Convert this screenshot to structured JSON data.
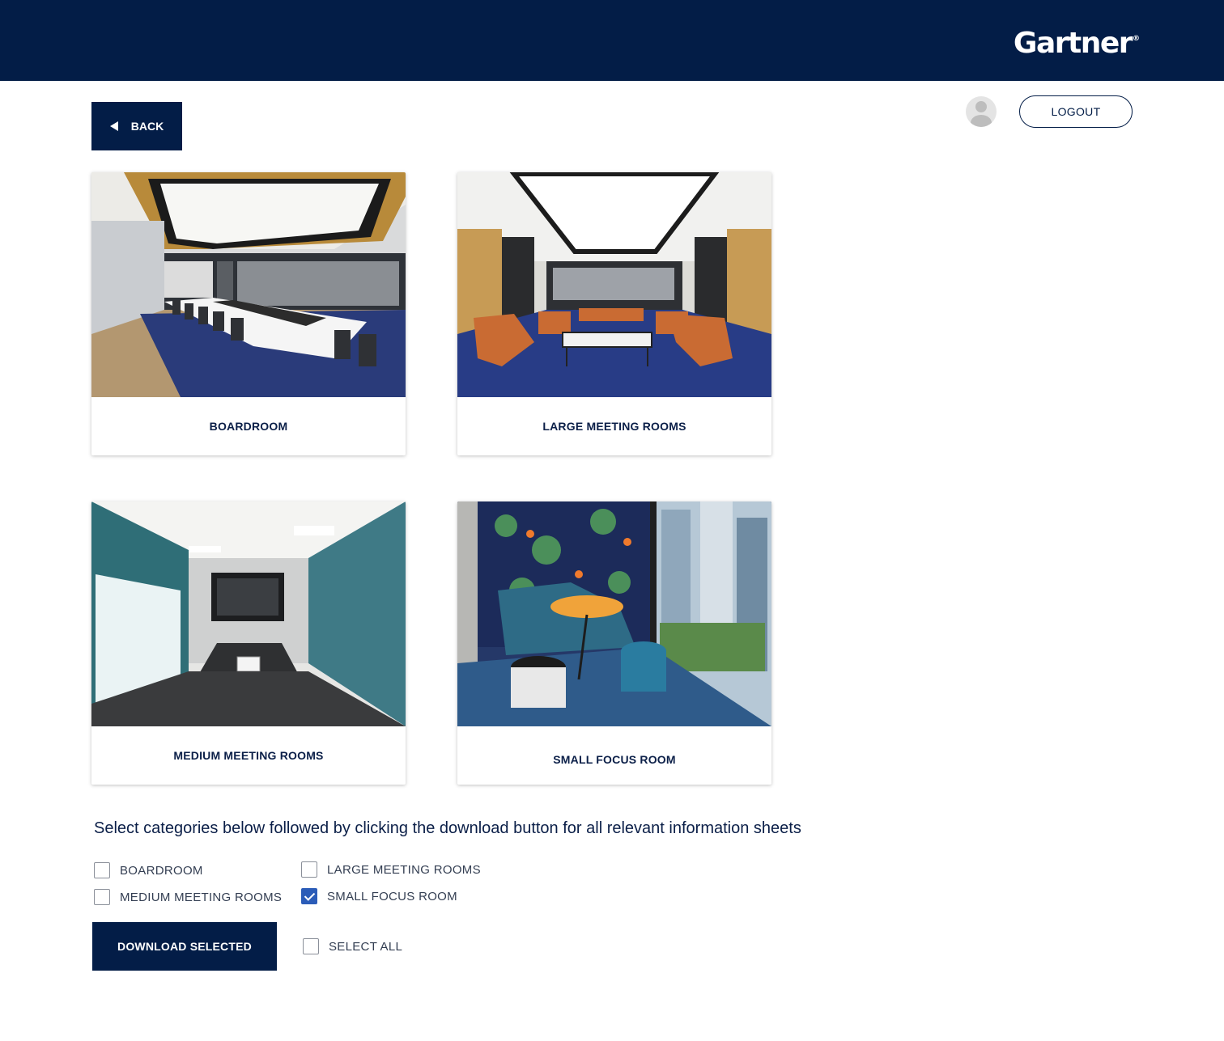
{
  "header": {
    "logo_text": "Gartner",
    "logo_mark": "®"
  },
  "nav": {
    "back_label": "BACK",
    "logout_label": "LOGOUT"
  },
  "cards": [
    {
      "label": "BOARDROOM"
    },
    {
      "label": "LARGE MEETING ROOMS"
    },
    {
      "label": "MEDIUM MEETING ROOMS"
    },
    {
      "label": "SMALL FOCUS ROOM"
    }
  ],
  "selection": {
    "instructions": "Select categories below followed by clicking the download button for all relevant information sheets",
    "options": [
      {
        "label": "BOARDROOM",
        "checked": false
      },
      {
        "label": "LARGE MEETING ROOMS",
        "checked": false
      },
      {
        "label": "MEDIUM MEETING ROOMS",
        "checked": false
      },
      {
        "label": "SMALL FOCUS ROOM",
        "checked": true
      }
    ],
    "download_label": "DOWNLOAD SELECTED",
    "select_all_label": "SELECT ALL",
    "select_all_checked": false
  },
  "colors": {
    "navy": "#031d47",
    "checkbox_accent": "#2b5cb8"
  }
}
